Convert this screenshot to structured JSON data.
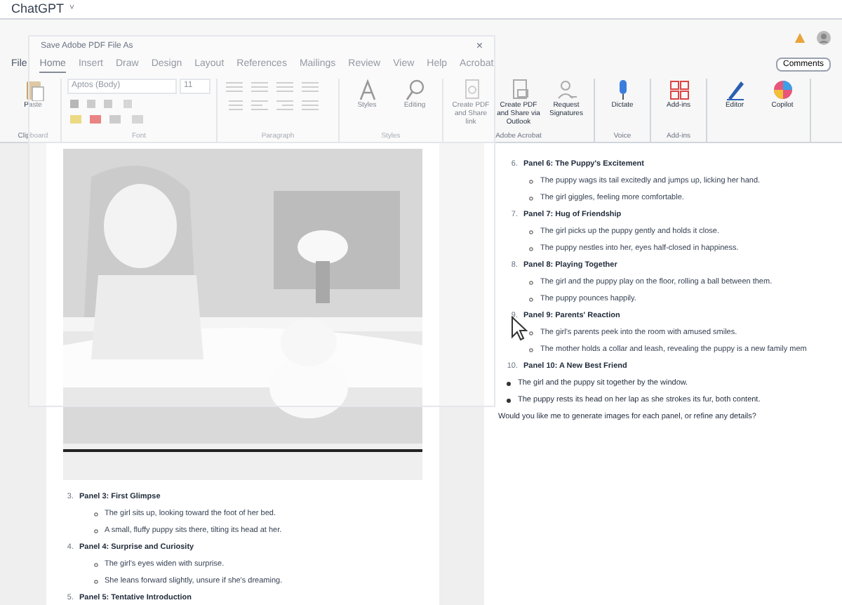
{
  "app": {
    "title": "ChatGPT",
    "caret": "˅",
    "comments": "Comments"
  },
  "dialog": {
    "title": "Save Adobe PDF File As",
    "close": "×"
  },
  "tabs": [
    {
      "label": "File",
      "selected": false
    },
    {
      "label": "Home",
      "selected": true
    },
    {
      "label": "Insert",
      "selected": false
    },
    {
      "label": "Draw",
      "selected": false
    },
    {
      "label": "Design",
      "selected": false
    },
    {
      "label": "Layout",
      "selected": false
    },
    {
      "label": "References",
      "selected": false
    },
    {
      "label": "Mailings",
      "selected": false
    },
    {
      "label": "Review",
      "selected": false
    },
    {
      "label": "View",
      "selected": false
    },
    {
      "label": "Help",
      "selected": false
    },
    {
      "label": "Acrobat",
      "selected": false
    }
  ],
  "font": {
    "name": "Aptos (Body)",
    "size": "11"
  },
  "groups": [
    {
      "label": "Clipboard",
      "buttons": [
        {
          "kind": "paste",
          "label": "Paste"
        }
      ]
    },
    {
      "label": "Font",
      "buttons": [
        {
          "kind": "font"
        }
      ]
    },
    {
      "label": "Paragraph",
      "buttons": [
        {
          "kind": "paragraph"
        }
      ]
    },
    {
      "label": "Styles",
      "buttons": [
        {
          "kind": "styles",
          "label": "Styles"
        },
        {
          "kind": "editing",
          "label": "Editing"
        }
      ]
    },
    {
      "label": "Adobe Acrobat",
      "buttons": [
        {
          "kind": "pdf",
          "label": "Create PDF and Share link"
        },
        {
          "kind": "pdfmail",
          "label": "Create PDF and Share via Outlook"
        },
        {
          "kind": "sign",
          "label": "Request Signatures"
        }
      ]
    },
    {
      "label": "Voice",
      "buttons": [
        {
          "kind": "mic",
          "label": "Dictate"
        }
      ]
    },
    {
      "label": "Add-ins",
      "buttons": [
        {
          "kind": "addins",
          "label": "Add-ins"
        }
      ]
    },
    {
      "buttons": [
        {
          "kind": "editor",
          "label": "Editor"
        },
        {
          "kind": "copilot",
          "label": "Copilot"
        }
      ]
    }
  ],
  "document": [
    {
      "number": "3.",
      "title": "Panel 3: First Glimpse",
      "items": [
        "The girl sits up, looking toward the foot of her bed.",
        "A small, fluffy puppy sits there, tilting its head at her."
      ]
    },
    {
      "number": "4.",
      "title": "Panel 4: Surprise and Curiosity",
      "items": [
        "The girl's eyes widen with surprise.",
        "She leans forward slightly, unsure if she's dreaming."
      ]
    },
    {
      "number": "5.",
      "title": "Panel 5: Tentative Introduction"
    }
  ],
  "chat": {
    "panels": [
      {
        "number": "6.",
        "title": "Panel 6: The Puppy's Excitement",
        "items": [
          "The puppy wags its tail excitedly and jumps up, licking her hand.",
          "The girl giggles, feeling more comfortable."
        ]
      },
      {
        "number": "7.",
        "title": "Panel 7: Hug of Friendship",
        "items": [
          "The girl picks up the puppy gently and holds it close.",
          "The puppy nestles into her, eyes half-closed in happiness."
        ]
      },
      {
        "number": "8.",
        "title": "Panel 8: Playing Together",
        "items": [
          "The girl and the puppy play on the floor, rolling a ball between them.",
          "The puppy pounces happily."
        ]
      },
      {
        "number": "9.",
        "title": "Panel 9: Parents' Reaction",
        "items": [
          "The girl's parents peek into the room with amused smiles.",
          "The mother holds a collar and leash, revealing the puppy is a new family mem"
        ]
      },
      {
        "number": "10.",
        "title": "Panel 10: A New Best Friend"
      }
    ],
    "bullets": [
      "The girl and the puppy sit together by the window.",
      "The puppy rests its head on her lap as she strokes its fur, both content."
    ],
    "question": "Would you like me to generate images for each panel, or refine any details?"
  }
}
